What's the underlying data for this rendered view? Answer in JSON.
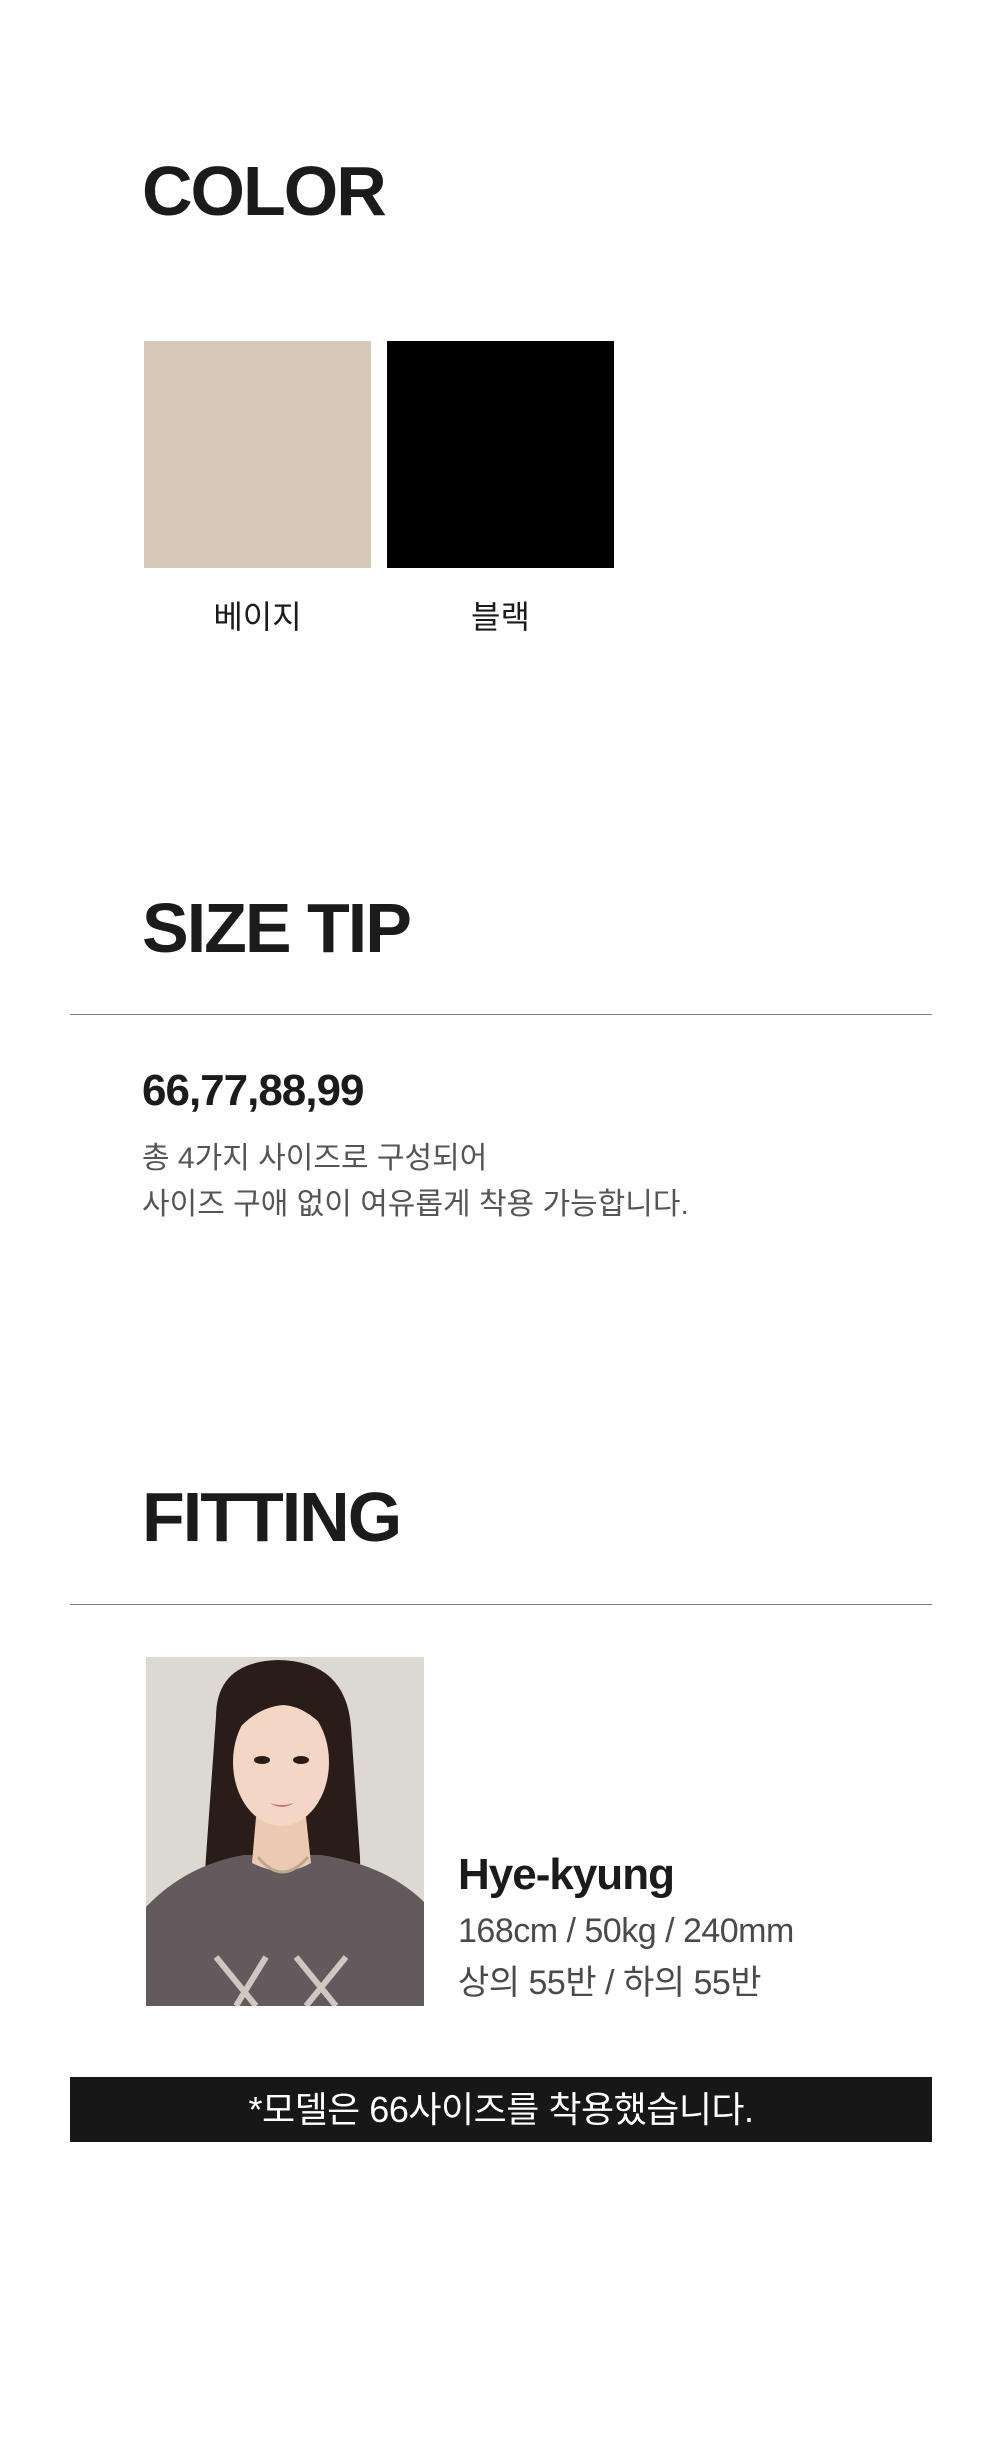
{
  "color_section": {
    "title": "COLOR",
    "swatches": [
      {
        "label": "베이지",
        "color": "#d5c8b7"
      },
      {
        "label": "블랙",
        "color": "#000000"
      }
    ]
  },
  "size_section": {
    "title": "SIZE TIP",
    "sizes": "66,77,88,99",
    "description_line1": "총 4가지 사이즈로 구성되어",
    "description_line2": "사이즈 구애 없이 여유롭게 착용 가능합니다."
  },
  "fitting_section": {
    "title": "FITTING",
    "model": {
      "name": "Hye-kyung",
      "measurements": "168cm / 50kg / 240mm",
      "sizes_worn": "상의 55반 / 하의 55반"
    },
    "notice": "*모델은 66사이즈를 착용했습니다."
  }
}
